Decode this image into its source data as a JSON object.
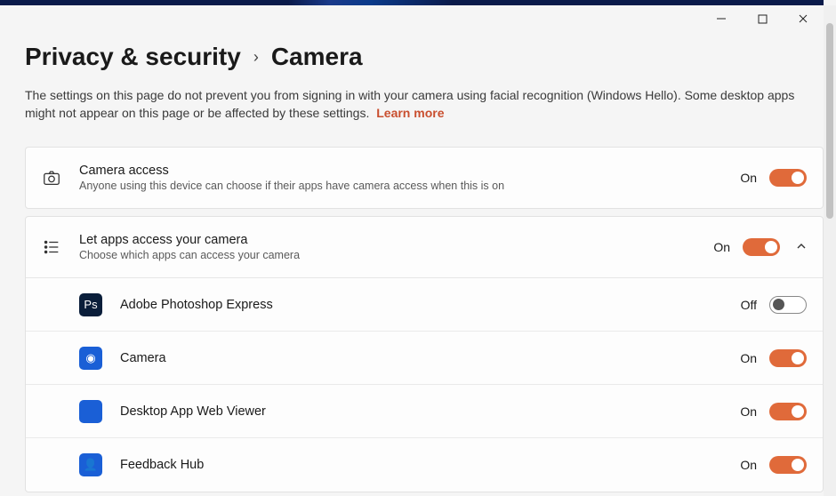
{
  "window": {
    "minimize": "—",
    "maximize": "▢",
    "close": "✕"
  },
  "breadcrumb": {
    "parent": "Privacy & security",
    "separator": "›",
    "current": "Camera"
  },
  "description": "The settings on this page do not prevent you from signing in with your camera using facial recognition (Windows Hello). Some desktop apps might not appear on this page or be affected by these settings.",
  "learn_more": "Learn more",
  "camera_access": {
    "title": "Camera access",
    "subtitle": "Anyone using this device can choose if their apps have camera access when this is on",
    "state": "On"
  },
  "apps_access": {
    "title": "Let apps access your camera",
    "subtitle": "Choose which apps can access your camera",
    "state": "On"
  },
  "apps": [
    {
      "name": "Adobe Photoshop Express",
      "state": "Off",
      "icon_bg": "#0a1e3a",
      "icon_txt": "Ps"
    },
    {
      "name": "Camera",
      "state": "On",
      "icon_bg": "#1a5fd6",
      "icon_txt": "◉"
    },
    {
      "name": "Desktop App Web Viewer",
      "state": "On",
      "icon_bg": "#1a5fd6",
      "icon_txt": ""
    },
    {
      "name": "Feedback Hub",
      "state": "On",
      "icon_bg": "#1a5fd6",
      "icon_txt": "👤"
    }
  ]
}
